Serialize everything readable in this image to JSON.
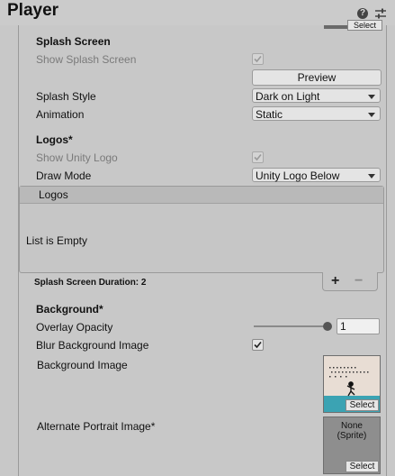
{
  "header": {
    "title": "Player"
  },
  "top_texture": {
    "select_label": "Select"
  },
  "splash": {
    "section_title": "Splash Screen",
    "show_splash_label": "Show Splash Screen",
    "show_splash_checked": true,
    "preview_label": "Preview",
    "style_label": "Splash Style",
    "style_value": "Dark on Light",
    "animation_label": "Animation",
    "animation_value": "Static"
  },
  "logos": {
    "section_title": "Logos*",
    "show_unity_logo_label": "Show Unity Logo",
    "show_unity_logo_checked": true,
    "draw_mode_label": "Draw Mode",
    "draw_mode_value": "Unity Logo Below",
    "list_header": "Logos",
    "list_empty_text": "List is Empty",
    "add_label": "+",
    "remove_label": "−",
    "duration_text": "Splash Screen Duration: 2"
  },
  "background": {
    "section_title": "Background*",
    "overlay_label": "Overlay Opacity",
    "overlay_value": "1",
    "overlay_fraction": 1,
    "blur_label": "Blur Background Image",
    "blur_checked": true,
    "bg_image_label": "Background Image",
    "bg_image_select": "Select",
    "alt_portrait_label": "Alternate Portrait Image*",
    "alt_portrait_none": "None\n(Sprite)",
    "alt_portrait_select": "Select"
  },
  "icons": {
    "help": "help-icon",
    "settings": "settings-sliders-icon",
    "checkmark": "checkmark-icon",
    "dropdown": "chevron-down-icon"
  },
  "colors": {
    "panel_bg": "#c8c8c8",
    "field_bg": "#e4e4e4",
    "texture_preview_bg": "#e8ddd4",
    "texture_preview_floor": "#3ba3b3"
  }
}
